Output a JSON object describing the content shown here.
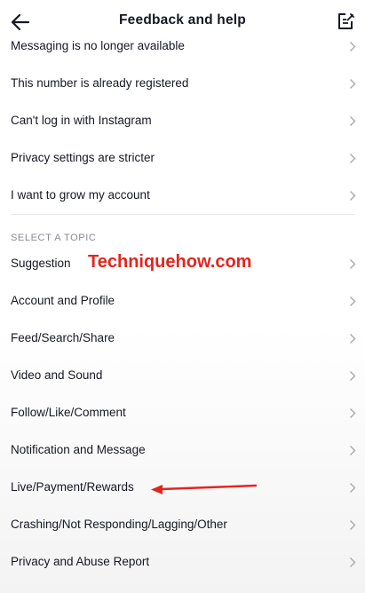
{
  "header": {
    "title": "Feedback and help",
    "back_icon": "arrow-left-icon",
    "edit_icon": "edit-note-icon"
  },
  "top_items": [
    {
      "label": "Messaging is no longer available"
    },
    {
      "label": "This number is already registered"
    },
    {
      "label": "Can't log in with Instagram"
    },
    {
      "label": "Privacy settings are stricter"
    },
    {
      "label": "I want to grow my account"
    }
  ],
  "section": {
    "title": "SELECT A TOPIC"
  },
  "topics": [
    {
      "label": "Suggestion"
    },
    {
      "label": "Account and Profile"
    },
    {
      "label": "Feed/Search/Share"
    },
    {
      "label": "Video and Sound"
    },
    {
      "label": "Follow/Like/Comment"
    },
    {
      "label": "Notification and Message"
    },
    {
      "label": "Live/Payment/Rewards"
    },
    {
      "label": "Crashing/Not Responding/Lagging/Other"
    },
    {
      "label": "Privacy and Abuse Report"
    }
  ],
  "watermark": {
    "text": "Techniquehow.com",
    "color": "#e5241f"
  },
  "colors": {
    "text": "#161823",
    "secondary": "#8a8b91",
    "chevron": "#a8a9ad",
    "annotation": "#e5241f"
  }
}
